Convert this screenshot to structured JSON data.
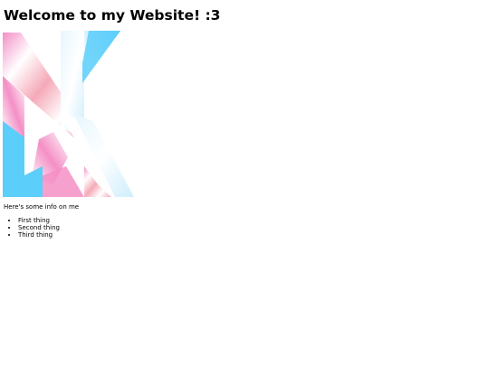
{
  "page": {
    "heading": "Welcome to my Website! :3",
    "intro": "Here's some info on me",
    "items": [
      "First thing",
      "Second thing",
      "Third thing"
    ]
  },
  "logo": {
    "icon": "kx-logo-icon",
    "colors": {
      "blue": "#5BCEFA",
      "pink": "#F5A9B8",
      "pink_deep": "#F48FC6",
      "white": "#FFFFFF"
    }
  }
}
